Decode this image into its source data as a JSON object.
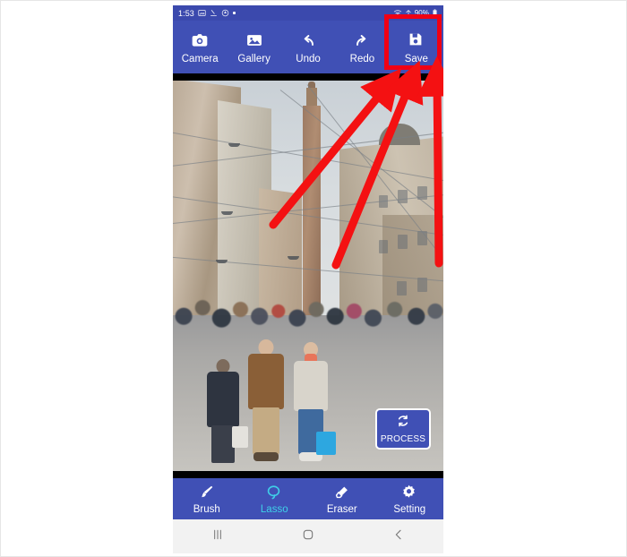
{
  "status_bar": {
    "time": "1:53",
    "left_icons": [
      "photo-icon",
      "download-icon",
      "drop-icon",
      "dot-icon"
    ],
    "right_icons": [
      "wifi-icon",
      "signal-icon",
      "battery-icon"
    ],
    "battery_text": "90%"
  },
  "top_toolbar": {
    "background": "#4050b5",
    "items": [
      {
        "label": "Camera",
        "icon": "camera-icon"
      },
      {
        "label": "Gallery",
        "icon": "gallery-icon"
      },
      {
        "label": "Undo",
        "icon": "undo-icon"
      },
      {
        "label": "Redo",
        "icon": "redo-icon"
      },
      {
        "label": "Save",
        "icon": "save-icon"
      }
    ]
  },
  "canvas": {
    "help_badge": "?",
    "process_button": {
      "label": "PROCESS",
      "icon": "refresh-icon"
    },
    "photo_description": "Busy pedestrian street with crowd, historic tower and buildings"
  },
  "bottom_toolbar": {
    "background": "#4050b5",
    "active_color": "#3fd0e8",
    "active_item": "Lasso",
    "items": [
      {
        "label": "Brush",
        "icon": "brush-icon",
        "active": false
      },
      {
        "label": "Lasso",
        "icon": "lasso-icon",
        "active": true
      },
      {
        "label": "Eraser",
        "icon": "eraser-icon",
        "active": false
      },
      {
        "label": "Setting",
        "icon": "gear-icon",
        "active": false
      }
    ]
  },
  "nav_bar": {
    "items": [
      {
        "icon": "recents-icon",
        "label": "Recents"
      },
      {
        "icon": "home-icon",
        "label": "Home"
      },
      {
        "icon": "back-icon",
        "label": "Back"
      }
    ]
  },
  "annotations": {
    "highlight_color": "#f00014",
    "arrow_color": "#f41112",
    "highlight_target": "Save",
    "arrow_count": 3
  }
}
